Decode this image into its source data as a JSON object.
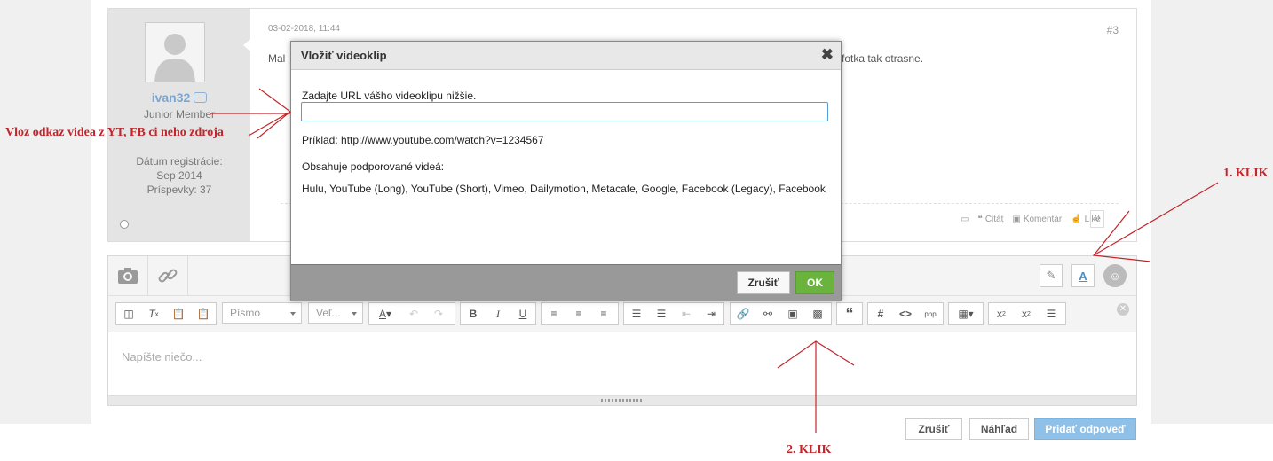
{
  "post": {
    "username": "ivan32",
    "rank": "Junior Member",
    "reg_label": "Dátum registrácie:",
    "reg_date": "Sep 2014",
    "posts_label": "Príspevky: 37",
    "date": "03-02-2018, 11:44",
    "number": "#3",
    "text_start": "Mal",
    "text_end": "fotka tak otrasne.",
    "actions": {
      "quote": "Citát",
      "comment": "Komentár",
      "like": "Like",
      "like_count": "0"
    }
  },
  "modal": {
    "title": "Vložiť videoklip",
    "prompt": "Zadajte URL vášho videoklipu nižšie.",
    "input_value": "",
    "example": "Príklad: http://www.youtube.com/watch?v=1234567",
    "supported_label": "Obsahuje podporované videá:",
    "supported_list": "Hulu, YouTube (Long), YouTube (Short), Vimeo, Dailymotion, Metacafe, Google, Facebook (Legacy), Facebook",
    "cancel": "Zrušiť",
    "ok": "OK"
  },
  "toolbar": {
    "font": "Písmo",
    "size": "Veľ...",
    "placeholder": "Napíšte niečo..."
  },
  "buttons": {
    "cancel": "Zrušiť",
    "preview": "Náhľad",
    "submit": "Pridať odpoveď"
  },
  "annotations": {
    "hint": "Vloz odkaz videa z YT, FB ci neho zdroja",
    "click1": "1. KLIK",
    "click2": "2. KLIK"
  },
  "colors": {
    "accent": "#8fc1e8",
    "ok": "#6ab43e",
    "annotation": "#c0262b"
  }
}
